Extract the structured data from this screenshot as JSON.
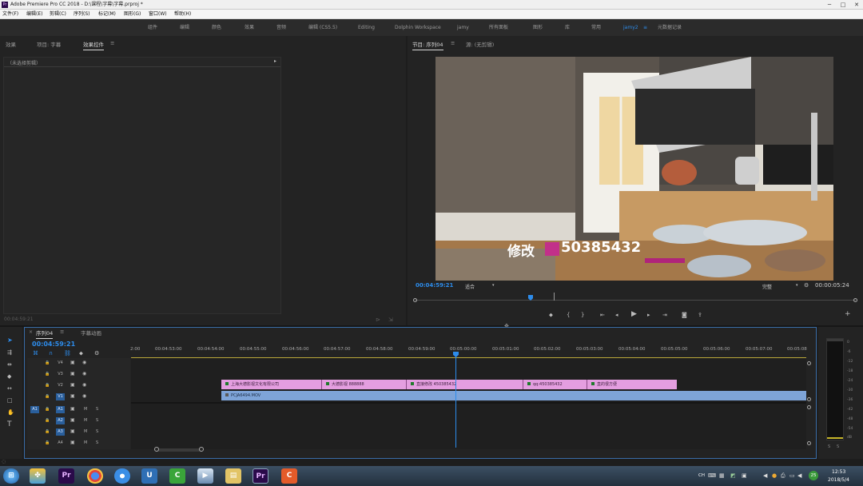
{
  "window": {
    "title": "Adobe Premiere Pro CC 2018 - D:\\课程\\字幕\\字幕.prproj *",
    "minimize": "─",
    "maximize": "□",
    "close": "✕"
  },
  "menu": [
    "文件(F)",
    "编辑(E)",
    "剪辑(C)",
    "序列(S)",
    "标记(M)",
    "图形(G)",
    "窗口(W)",
    "帮助(H)"
  ],
  "workspaces": {
    "items": [
      "组件",
      "编辑",
      "颜色",
      "效果",
      "音频",
      "编辑 (CS5.5)",
      "Editing",
      "Dolphin Workspace",
      "jamy",
      "所有面板",
      "图形",
      "库",
      "常用",
      "jamy2",
      "元数据记录"
    ],
    "active": "jamy2",
    "menu_icon": "≡"
  },
  "left_panel": {
    "tabs": [
      "效果",
      "项目: 字幕",
      "效果控件"
    ],
    "active_tab": "效果控件",
    "tab_menu": "≡",
    "no_clip_text": "（未选择剪辑）",
    "timecode": "00:04:59:21"
  },
  "program_monitor": {
    "tabs": [
      "节目: 序列04",
      "源: (无剪辑)"
    ],
    "active_tab": "节目: 序列04",
    "tab_menu": "≡",
    "timecode_current": "00:04:59:21",
    "fit_option": "适合",
    "resolution_option": "完整",
    "timecode_duration": "00:00:05:24",
    "caption_text": "修改",
    "caption_number": "50385432",
    "overlay_colors": {
      "pink_block": "#c2308a",
      "pink_bar": "#b0247a"
    },
    "add_button": "+"
  },
  "timeline": {
    "tabs": [
      "序列04",
      "字幕动画"
    ],
    "active_tab": "序列04",
    "tab_close": "×",
    "tab_menu": "≡",
    "timecode": "00:04:59:21",
    "ruler_ticks": [
      "2:00",
      "00:04:53:00",
      "00:04:54:00",
      "00:04:55:00",
      "00:04:56:00",
      "00:04:57:00",
      "00:04:58:00",
      "00:04:59:00",
      "00:05:00:00",
      "00:05:01:00",
      "00:05:02:00",
      "00:05:03:00",
      "00:05:04:00",
      "00:05:05:00",
      "00:05:06:00",
      "00:05:07:00",
      "00:05:08"
    ],
    "video_tracks": [
      "V4",
      "V3",
      "V2",
      "V1"
    ],
    "audio_tracks": [
      "A1",
      "A2",
      "A3",
      "A4"
    ],
    "source_patch": "A1",
    "mute_label": "M",
    "solo_label": "S",
    "v2_clips": [
      "上海大德影视文化有限公司",
      "大德影视 888888",
      "直接修改 450385432",
      "qq:450385432",
      "直的很方便"
    ],
    "v1_clip": "PCJA6494.MOV",
    "colors": {
      "v2": "#e49ee0",
      "v1": "#7ea4d8",
      "playhead": "#2d8ceb"
    }
  },
  "audio_meter": {
    "labels": [
      "0",
      "-6",
      "-12",
      "-18",
      "-24",
      "-30",
      "-36",
      "-42",
      "-48",
      "-54",
      "dB"
    ],
    "solo_labels": [
      "S",
      "S"
    ]
  },
  "tools": [
    "selection-tool",
    "track-select-tool",
    "ripple-edit-tool",
    "razor-tool",
    "slip-tool",
    "pen-tool",
    "hand-tool",
    "type-tool"
  ],
  "taskbar": {
    "apps": [
      "windows-start",
      "pinwheel",
      "premiere",
      "chrome",
      "explorer-blue",
      "maxthon",
      "camtasia",
      "media-player",
      "folder",
      "premiere-active",
      "camtasia-recorder"
    ],
    "ime": "CH",
    "badge": "25",
    "time": "12:53",
    "date": "2018/5/4"
  }
}
